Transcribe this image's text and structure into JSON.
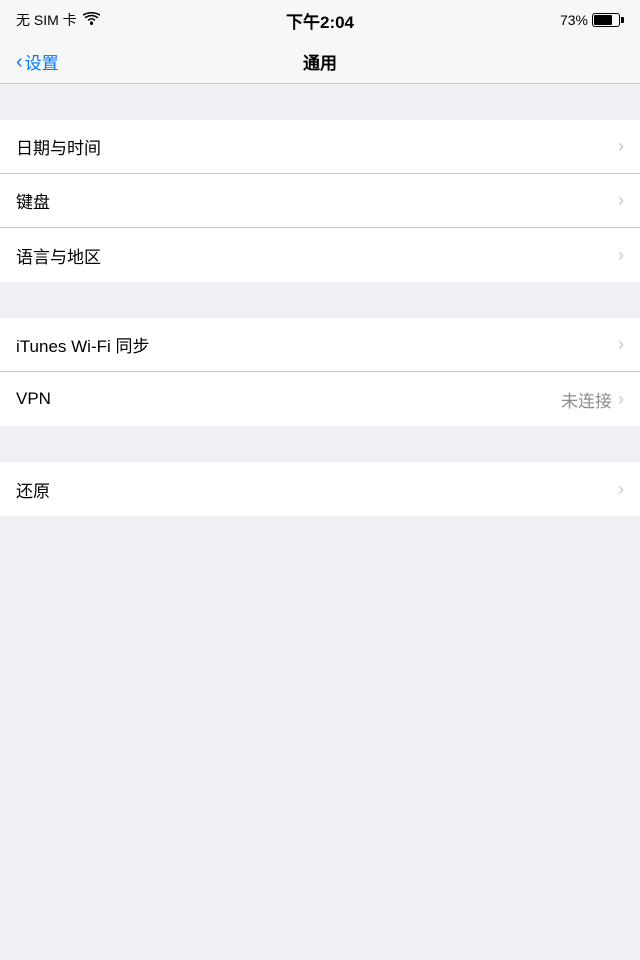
{
  "statusBar": {
    "carrier": "无 SIM 卡",
    "time": "下午2:04",
    "battery": "73%"
  },
  "navBar": {
    "backLabel": "设置",
    "title": "通用"
  },
  "sections": [
    {
      "id": "section1",
      "items": [
        {
          "id": "datetime",
          "label": "日期与时间",
          "value": "",
          "chevron": true
        },
        {
          "id": "keyboard",
          "label": "键盘",
          "value": "",
          "chevron": true
        },
        {
          "id": "language",
          "label": "语言与地区",
          "value": "",
          "chevron": true
        }
      ]
    },
    {
      "id": "section2",
      "items": [
        {
          "id": "itunes-wifi",
          "label": "iTunes Wi-Fi 同步",
          "value": "",
          "chevron": true
        },
        {
          "id": "vpn",
          "label": "VPN",
          "value": "未连接",
          "chevron": true
        }
      ]
    },
    {
      "id": "section3",
      "items": [
        {
          "id": "reset",
          "label": "还原",
          "value": "",
          "chevron": true
        }
      ]
    }
  ]
}
